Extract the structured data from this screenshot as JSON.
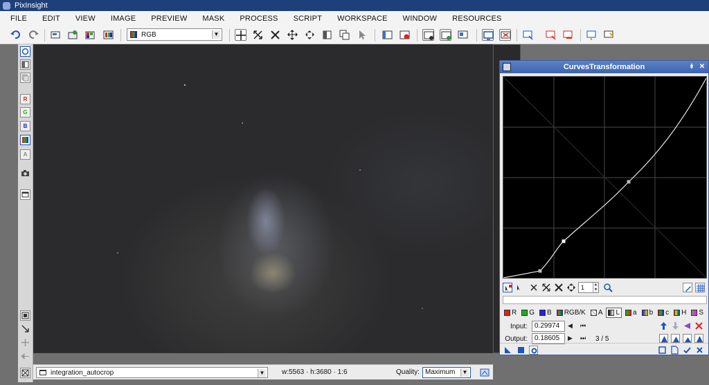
{
  "app": {
    "title": "PixInsight"
  },
  "menu": [
    "FILE",
    "EDIT",
    "VIEW",
    "IMAGE",
    "PREVIEW",
    "MASK",
    "PROCESS",
    "SCRIPT",
    "WORKSPACE",
    "WINDOW",
    "RESOURCES"
  ],
  "toolbar": {
    "channel_select": "RGB"
  },
  "left_toolbar": {
    "r": "R",
    "g": "G",
    "b": "B",
    "a": "A"
  },
  "image_window": {
    "view_name": "integration_autocrop",
    "dimensions": "w:5563 · h:3680 · 1:6",
    "quality_label": "Quality:",
    "quality_value": "Maximum"
  },
  "curves": {
    "title": "CurvesTransformation",
    "zoom_value": "1",
    "channels": [
      "R",
      "G",
      "B",
      "RGB/K",
      "A",
      "L",
      "a",
      "b",
      "c",
      "H",
      "S"
    ],
    "active_channel": "L",
    "input_label": "Input:",
    "input_value": "0.29974",
    "output_label": "Output:",
    "output_value": "0.18605",
    "point_count": "3 / 5"
  },
  "colors": {
    "titlebar": "#1e3f7a",
    "dialog_title": "#4a72bb",
    "curve": "#e6e6e6",
    "grid": "#4a4a4a"
  }
}
